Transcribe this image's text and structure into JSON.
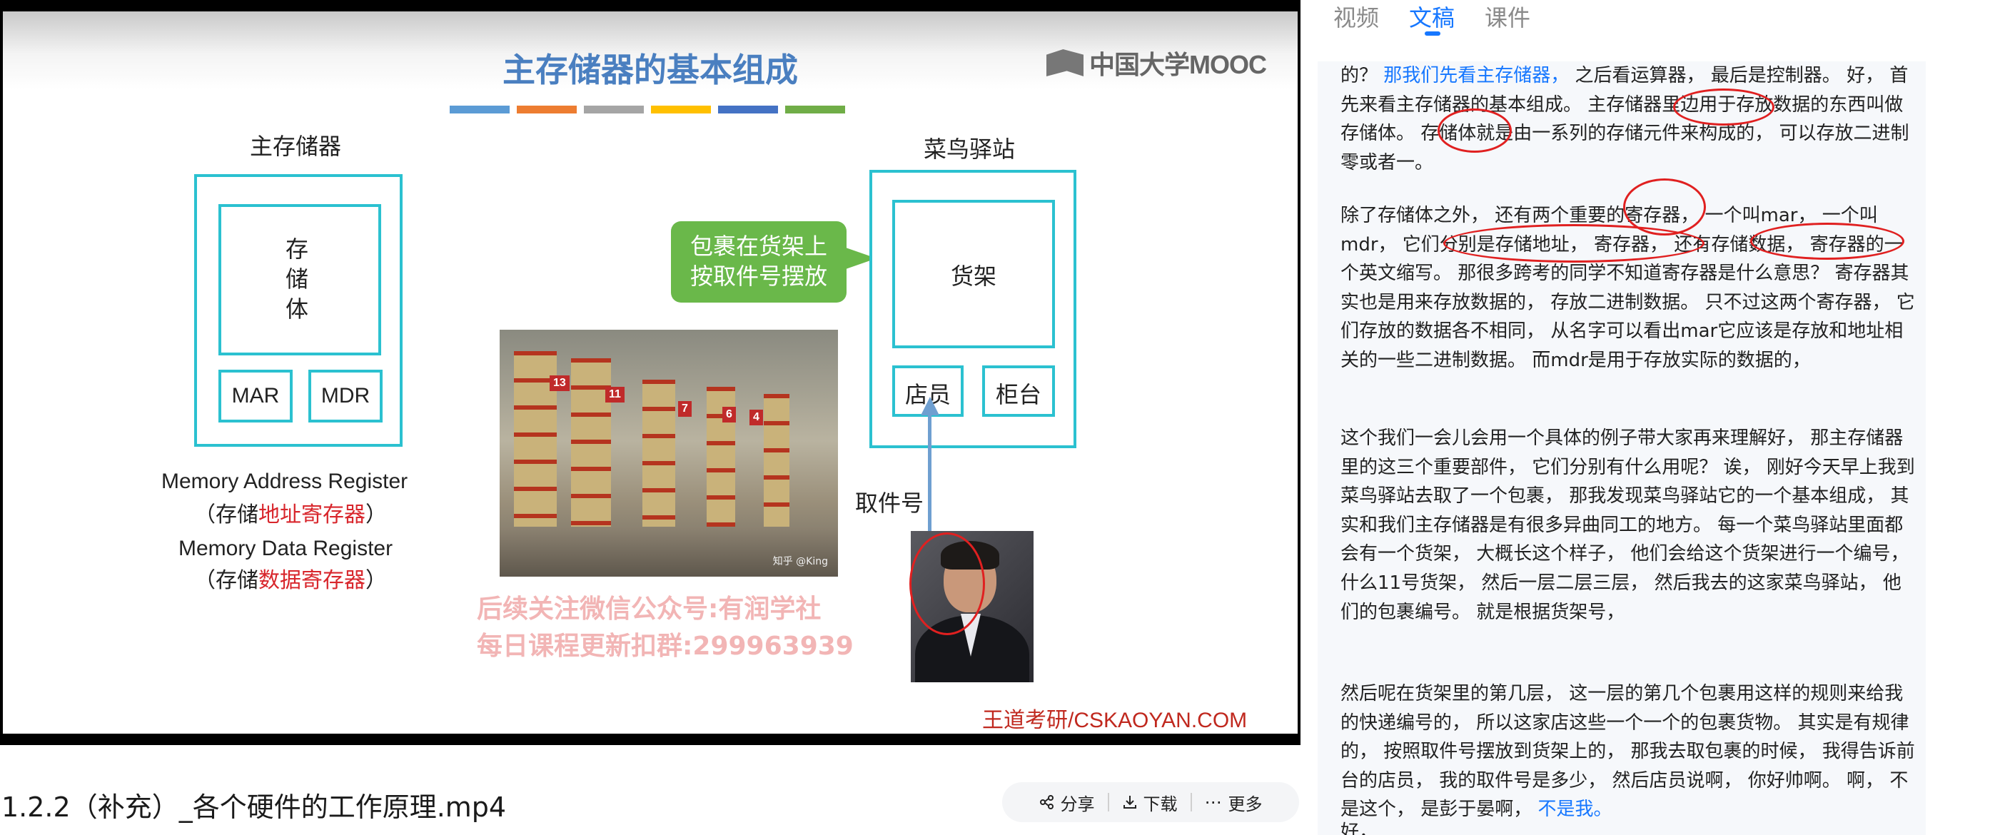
{
  "slide": {
    "title": "主存储器的基本组成",
    "mooc_logo": "中国大学MOOC",
    "bar_colors": [
      "#5b9bd5",
      "#ed7d31",
      "#a5a5a5",
      "#ffc000",
      "#4472c4",
      "#70ad47"
    ],
    "left_heading": "主存储器",
    "storage_body": [
      "存",
      "储",
      "体"
    ],
    "mar": "MAR",
    "mdr": "MDR",
    "mar_full": "Memory Address Register",
    "mar_cn_pre": "（存储",
    "mar_cn_red": "地址寄存器",
    "mar_cn_post": "）",
    "mdr_full": "Memory Data Register",
    "mdr_cn_pre": "（存储",
    "mdr_cn_red": "数据寄存器",
    "mdr_cn_post": "）",
    "right_heading": "菜鸟驿站",
    "shelf": "货架",
    "clerk": "店员",
    "counter": "柜台",
    "callout": [
      "包裹在货架上",
      "按取件号摆放"
    ],
    "pickup_label": "取件号",
    "rack_numbers": [
      "13",
      "11",
      "7",
      "6",
      "4"
    ],
    "photo_credit": "知乎 @King",
    "watermark": [
      "后续关注微信公众号:有润学社",
      "每日课程更新扣群:299963939"
    ],
    "brand": "王道考研/CSKAOYAN.COM"
  },
  "video_title": "1.2.2（补充）_各个硬件的工作原理.mp4",
  "actions": [
    {
      "icon": "share-icon",
      "label": "分享"
    },
    {
      "icon": "download-icon",
      "label": "下载"
    },
    {
      "icon": "more-icon",
      "label": "更多"
    }
  ],
  "tabs": [
    "视频",
    "文稿",
    "课件"
  ],
  "active_tab": "文稿",
  "transcript": {
    "p1_pre": "的？ ",
    "p1_link": "那我们先看主存储器，",
    "p1_post": " 之后看运算器， 最后是控制器。 好， 首先来看主存储器的基本组成。 主存储器里边用于存放数据的东西叫做存储体。 存储体就是由一系列的存储元件来构成的， 可以存放二进制零或者一。",
    "p2": "除了存储体之外， 还有两个重要的寄存器， 一个叫mar， 一个叫mdr， 它们分别是存储地址， 寄存器， 还有存储数据， 寄存器的一个英文缩写。 那很多跨考的同学不知道寄存器是什么意思？ 寄存器其实也是用来存放数据的， 存放二进制数据。 只不过这两个寄存器， 它们存放的数据各不相同， 从名字可以看出mar它应该是存放和地址相关的一些二进制数据。 而mdr是用于存放实际的数据的，",
    "p3": "这个我们一会儿会用一个具体的例子带大家再来理解好， 那主存储器里的这三个重要部件， 它们分别有什么用呢？ 诶， 刚好今天早上我到菜鸟驿站去取了一个包裹， 那我发现菜鸟驿站它的一个基本组成， 其实和我们主存储器是有很多异曲同工的地方。 每一个菜鸟驿站里面都会有一个货架， 大概长这个样子， 他们会给这个货架进行一个编号， 什么11号货架， 然后一层二层三层， 然后我去的这家菜鸟驿站， 他们的包裹编号。 就是根据货架号，",
    "p4_pre": "然后呢在货架里的第几层， 这一层的第几个包裹用这样的规则来给我的快递编号的， 所以这家店这些一个一个的包裹货物。 其实是有规律的， 按照取件号摆放到货架上的， 那我去取包裹的时候， 我得告诉前台的店员， 我的取件号是多少， 然后店员说啊， 你好帅啊。 啊， 不是这个， 是彭于晏啊， ",
    "p4_link": "不是我。",
    "p5": "好，"
  }
}
